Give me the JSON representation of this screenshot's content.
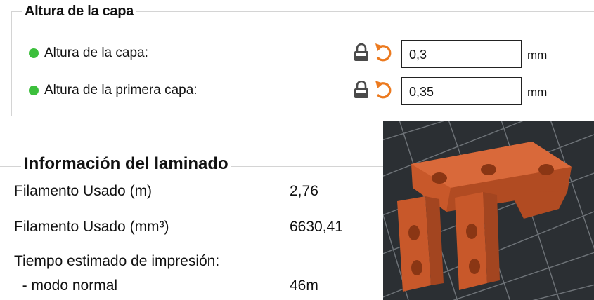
{
  "layer_group": {
    "title": "Altura de la capa",
    "params": [
      {
        "label": "Altura de la capa:",
        "value": "0,3",
        "unit": "mm",
        "status_color": "#3cbf3c"
      },
      {
        "label": "Altura de la primera capa:",
        "value": "0,35",
        "unit": "mm",
        "status_color": "#3cbf3c"
      }
    ],
    "icons": [
      "lock-icon",
      "undo-arrow-icon"
    ]
  },
  "slice_info": {
    "title": "Información del laminado",
    "rows": [
      {
        "label": "Filamento Usado (m)",
        "value": "2,76"
      },
      {
        "label": "Filamento Usado (mm³)",
        "value": "6630,41"
      },
      {
        "label": "Tiempo estimado de impresión:",
        "value": ""
      },
      {
        "label": "  - modo normal",
        "value": "46m"
      }
    ]
  },
  "preview": {
    "background_color": "#2b2f33",
    "part_color": "#c8582a"
  }
}
